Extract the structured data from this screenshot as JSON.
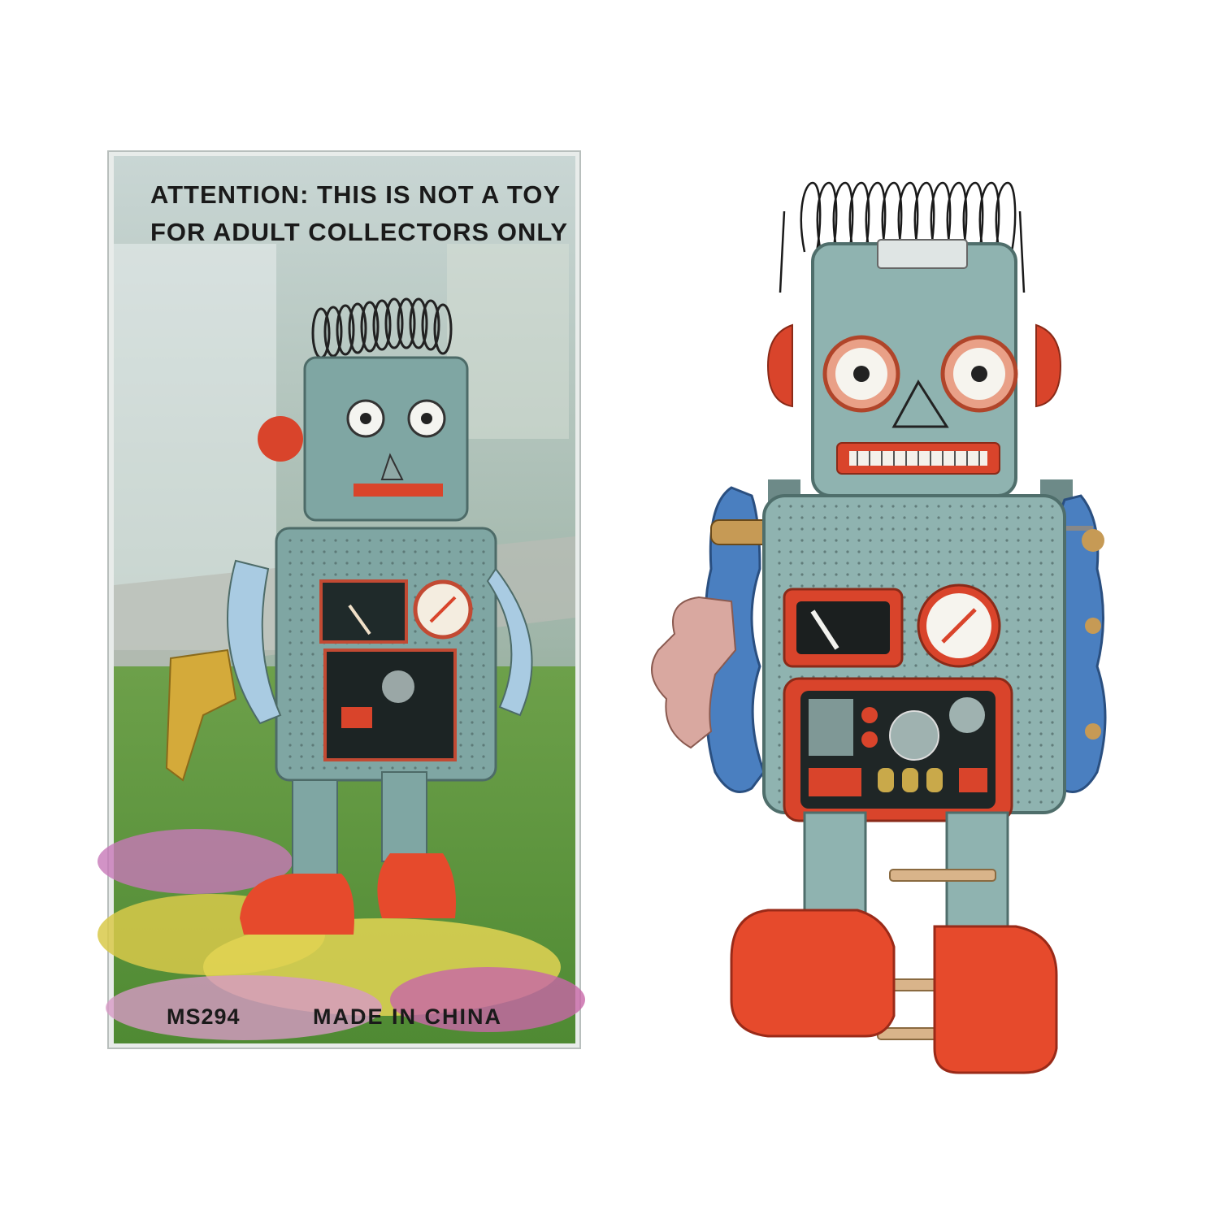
{
  "box": {
    "warning_line1": "ATTENTION: THIS IS  NOT  A  TOY",
    "warning_line2": "FOR ADULT COLLECTORS ONLY",
    "model_code": "MS294",
    "origin": "MADE  IN  CHINA"
  },
  "colors": {
    "background": "#ffffff",
    "robot_body": "#8fb3b0",
    "robot_red": "#d9442b",
    "robot_arm_blue": "#4a7fc0",
    "key_gold": "#d9a8a0",
    "grass": "#5f9a3a"
  }
}
